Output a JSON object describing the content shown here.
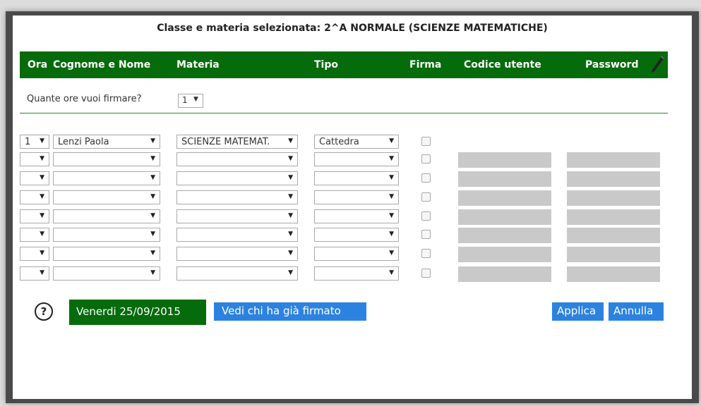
{
  "dialog": {
    "title": "Classe e materia selezionata: 2^A NORMALE (SCIENZE MATEMATICHE)"
  },
  "table": {
    "headers": {
      "ora": "Ora",
      "nome": "Cognome e Nome",
      "materia": "Materia",
      "tipo": "Tipo",
      "firma": "Firma",
      "codice": "Codice utente",
      "password": "Password"
    },
    "rows": [
      {
        "ora": "1",
        "nome": "Lenzi Paola",
        "materia": "SCIENZE MATEMAT.",
        "tipo": "Cattedra",
        "firma": false
      },
      {
        "ora": "",
        "nome": "",
        "materia": "",
        "tipo": "",
        "firma": false
      },
      {
        "ora": "",
        "nome": "",
        "materia": "",
        "tipo": "",
        "firma": false
      },
      {
        "ora": "",
        "nome": "",
        "materia": "",
        "tipo": "",
        "firma": false
      },
      {
        "ora": "",
        "nome": "",
        "materia": "",
        "tipo": "",
        "firma": false
      },
      {
        "ora": "",
        "nome": "",
        "materia": "",
        "tipo": "",
        "firma": false
      },
      {
        "ora": "",
        "nome": "",
        "materia": "",
        "tipo": "",
        "firma": false
      },
      {
        "ora": "",
        "nome": "",
        "materia": "",
        "tipo": "",
        "firma": false
      }
    ]
  },
  "hours": {
    "label": "Quante ore vuoi firmare?",
    "value": "1"
  },
  "icons": {
    "dropdown": "▼",
    "help": "?",
    "pen": "pen-icon"
  },
  "buttons": {
    "date": "Venerdi 25/09/2015",
    "vedi": "Vedi chi ha già firmato",
    "applica": "Applica",
    "annulla": "Annulla"
  },
  "colors": {
    "header_green": "#056b0b",
    "button_blue": "#2c82e0",
    "disabled_input": "#c9c9c9"
  }
}
